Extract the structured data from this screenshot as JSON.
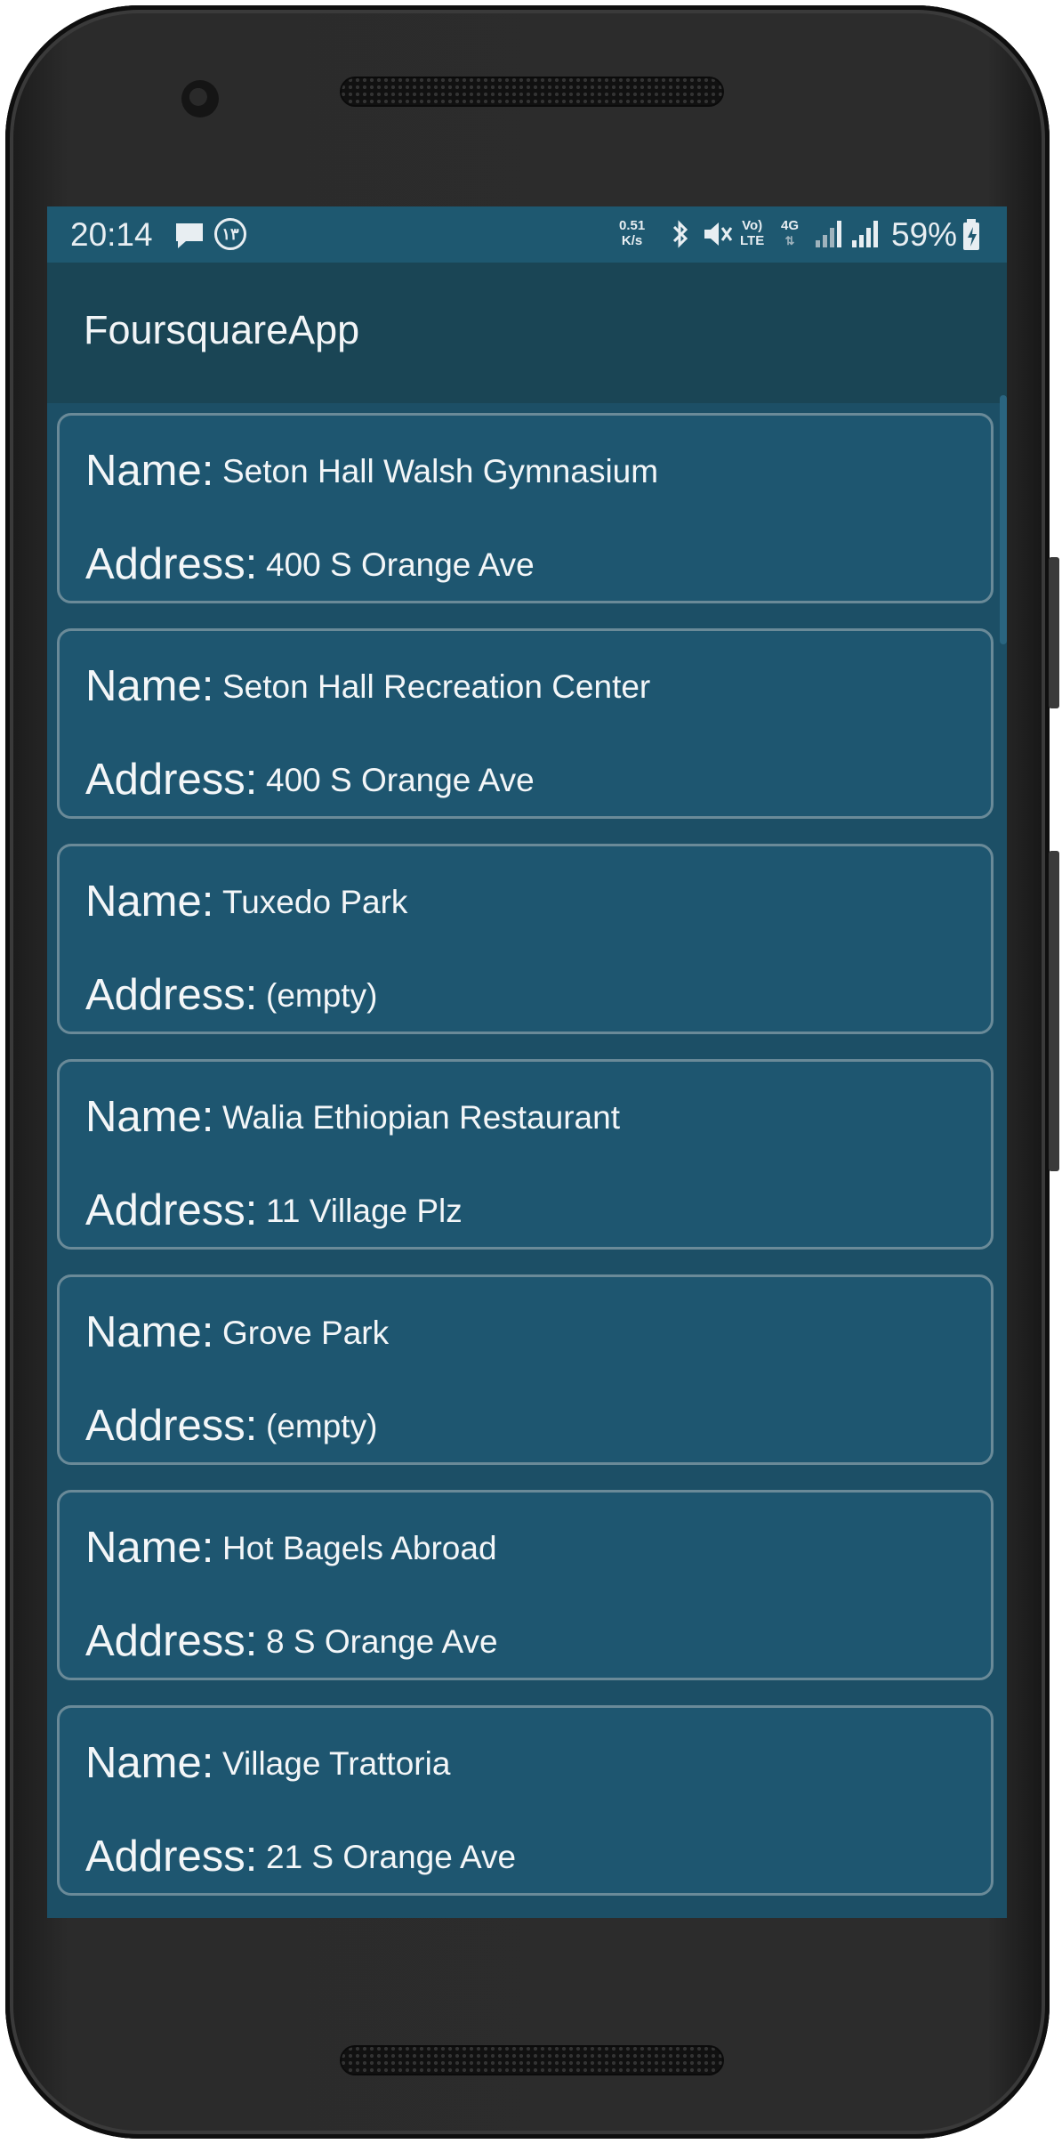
{
  "status_bar": {
    "time": "20:14",
    "net_speed_value": "0.51",
    "net_speed_unit": "K/s",
    "volte_top": "Vo)",
    "volte_bottom": "LTE",
    "network_type": "4G",
    "notification_badge": "١٣",
    "battery_percent": "59%"
  },
  "app_bar": {
    "title": "FoursquareApp"
  },
  "labels": {
    "name": "Name:",
    "address": "Address:"
  },
  "venues": [
    {
      "name": "Seton Hall Walsh Gymnasium",
      "address": "400 S Orange Ave"
    },
    {
      "name": "Seton Hall Recreation Center",
      "address": "400 S Orange Ave"
    },
    {
      "name": "Tuxedo Park",
      "address": "(empty)"
    },
    {
      "name": "Walia Ethiopian Restaurant",
      "address": "11 Village Plz"
    },
    {
      "name": "Grove Park",
      "address": "(empty)"
    },
    {
      "name": "Hot Bagels Abroad",
      "address": "8 S Orange Ave"
    },
    {
      "name": "Village Trattoria",
      "address": "21 S Orange Ave"
    }
  ],
  "colors": {
    "app_bar": "#1a4555",
    "status_bar": "#1e5870",
    "card_background": "#1e5670",
    "card_border": "#6a8a98"
  }
}
